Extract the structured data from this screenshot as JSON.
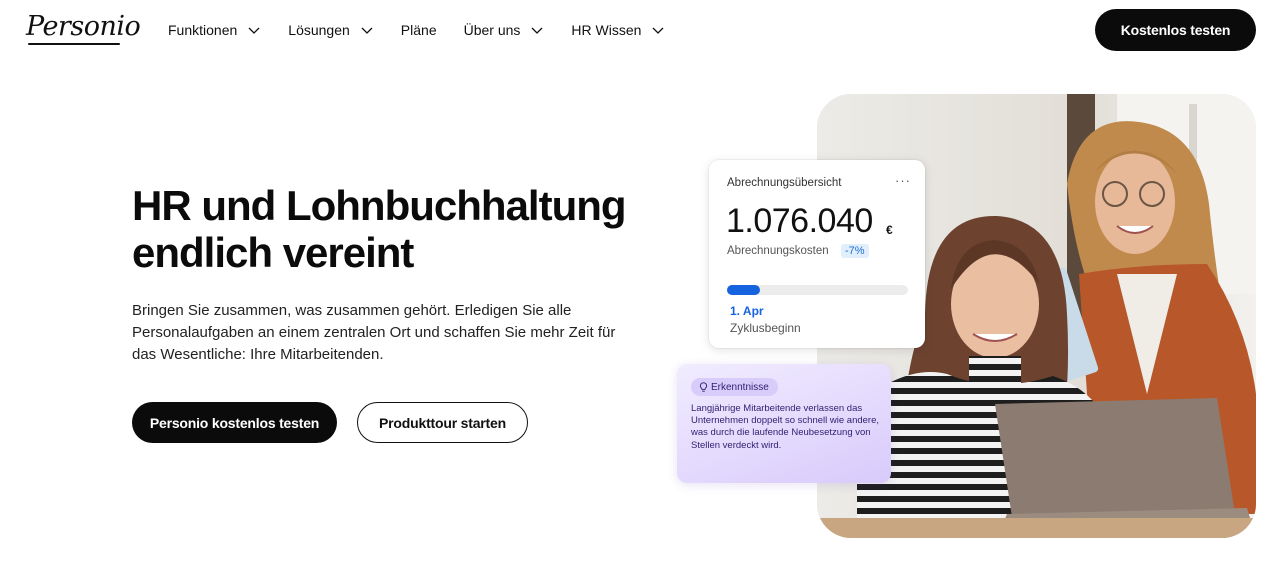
{
  "nav": {
    "logo": "Personio",
    "items": [
      {
        "label": "Funktionen",
        "has_dropdown": true
      },
      {
        "label": "Lösungen",
        "has_dropdown": true
      },
      {
        "label": "Pläne",
        "has_dropdown": false
      },
      {
        "label": "Über uns",
        "has_dropdown": true
      },
      {
        "label": "HR Wissen",
        "has_dropdown": true
      }
    ],
    "cta": "Kostenlos testen"
  },
  "hero": {
    "headline_line1": "HR und Lohnbuchhaltung",
    "headline_line2": "endlich vereint",
    "subtext": "Bringen Sie zusammen, was zusammen gehört.  Erledigen Sie alle Personalaufgaben an einem zentralen Ort und schaffen Sie mehr Zeit für das Wesentliche: Ihre Mitarbeitenden.",
    "primary_button": "Personio kostenlos testen",
    "secondary_button": "Produkttour starten"
  },
  "payroll_card": {
    "title": "Abrechnungsübersicht",
    "more": "···",
    "amount": "1.076.040",
    "currency": "€",
    "label": "Abrechnungskosten",
    "badge": "-7%",
    "progress": 0.18,
    "date": "1. Apr",
    "date_label": "Zyklusbeginn"
  },
  "insight_card": {
    "chip": "Erkenntnisse",
    "text": "Langjährige Mitarbeitende verlassen das Unternehmen doppelt so schnell wie andere, was durch die laufende Neubesetzung von Stellen verdeckt wird."
  },
  "colors": {
    "primary": "#0b0b0b",
    "accent_blue": "#1663e0",
    "insight_purple": "#e4dafd"
  }
}
